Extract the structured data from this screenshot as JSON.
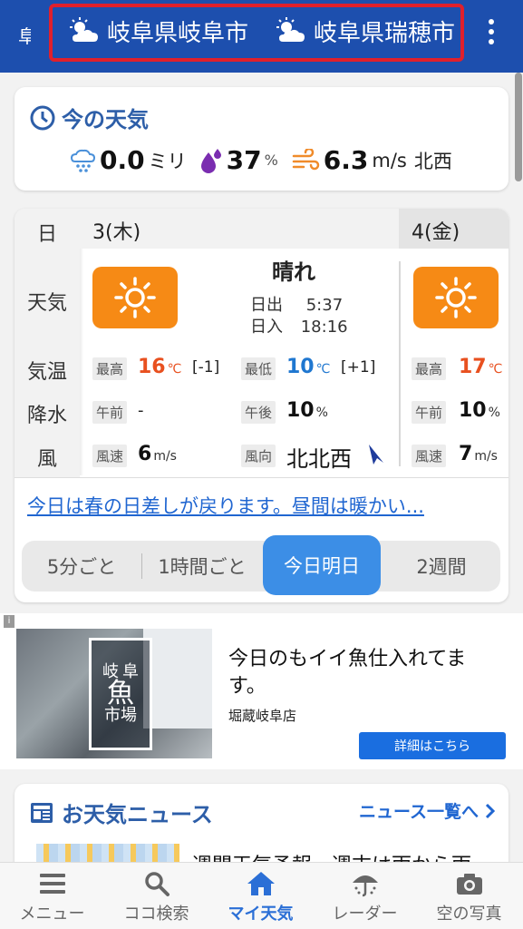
{
  "topbar": {
    "partial_tab": "阜",
    "locations": [
      "岐阜県岐阜市",
      "岐阜県瑞穂市"
    ],
    "location_icon": "sun-cloud-icon",
    "menu_icon": "more-vert-icon",
    "bg_color": "#1d4fae",
    "highlight_color": "#e0202c"
  },
  "now": {
    "title": "今の天気",
    "rain_value": "0.0",
    "rain_unit": "ミリ",
    "humidity_value": "37",
    "humidity_unit": "%",
    "wind_value": "6.3",
    "wind_unit": "m/s",
    "wind_dir": "北西"
  },
  "forecast": {
    "row_labels": {
      "day": "日",
      "weather": "天気",
      "temp": "気温",
      "precip": "降水",
      "wind": "風"
    },
    "day1": {
      "label": "3(木)",
      "condition": "晴れ",
      "sunrise_label": "日出",
      "sunrise": "5:37",
      "sunset_label": "日入",
      "sunset": "18:16",
      "max_label": "最高",
      "max": "16",
      "max_diff": "[-1]",
      "min_label": "最低",
      "min": "10",
      "min_diff": "[+1]",
      "temp_unit": "℃",
      "am_label": "午前",
      "am": "-",
      "pm_label": "午後",
      "pm": "10",
      "pct": "%",
      "wind_speed_label": "風速",
      "wind_speed": "6",
      "wind_unit": "m/s",
      "wind_dir_label": "風向",
      "wind_dir": "北北西"
    },
    "day2": {
      "label": "4(金)",
      "max_label": "最高",
      "max": "17",
      "temp_unit": "℃",
      "am_label": "午前",
      "am": "10",
      "pct": "%",
      "wind_speed_label": "風速",
      "wind_speed": "7",
      "wind_unit": "m/s"
    },
    "comment_link": "今日は春の日差しが戻ります。昼間は暖かい...",
    "tabs": [
      "5分ごと",
      "1時間ごと",
      "今日明日",
      "2週間"
    ],
    "active_tab": "今日明日"
  },
  "ad": {
    "info": "i",
    "image_text": [
      "岐",
      "阜",
      "魚",
      "市",
      "場"
    ],
    "headline": "今日のもイイ魚仕入れてます。",
    "shop": "堀蔵岐阜店",
    "button": "詳細はこちら"
  },
  "news": {
    "title": "お天気ニュース",
    "more": "ニュース一覧へ",
    "headline": "週間天気予報　週末は雨から雨"
  },
  "bottom_nav": [
    {
      "label": "メニュー",
      "icon": "hamburger-icon"
    },
    {
      "label": "ココ検索",
      "icon": "search-icon"
    },
    {
      "label": "マイ天気",
      "icon": "home-icon"
    },
    {
      "label": "レーダー",
      "icon": "radar-umbrella-icon"
    },
    {
      "label": "空の写真",
      "icon": "camera-icon"
    }
  ],
  "active_nav": "マイ天気"
}
